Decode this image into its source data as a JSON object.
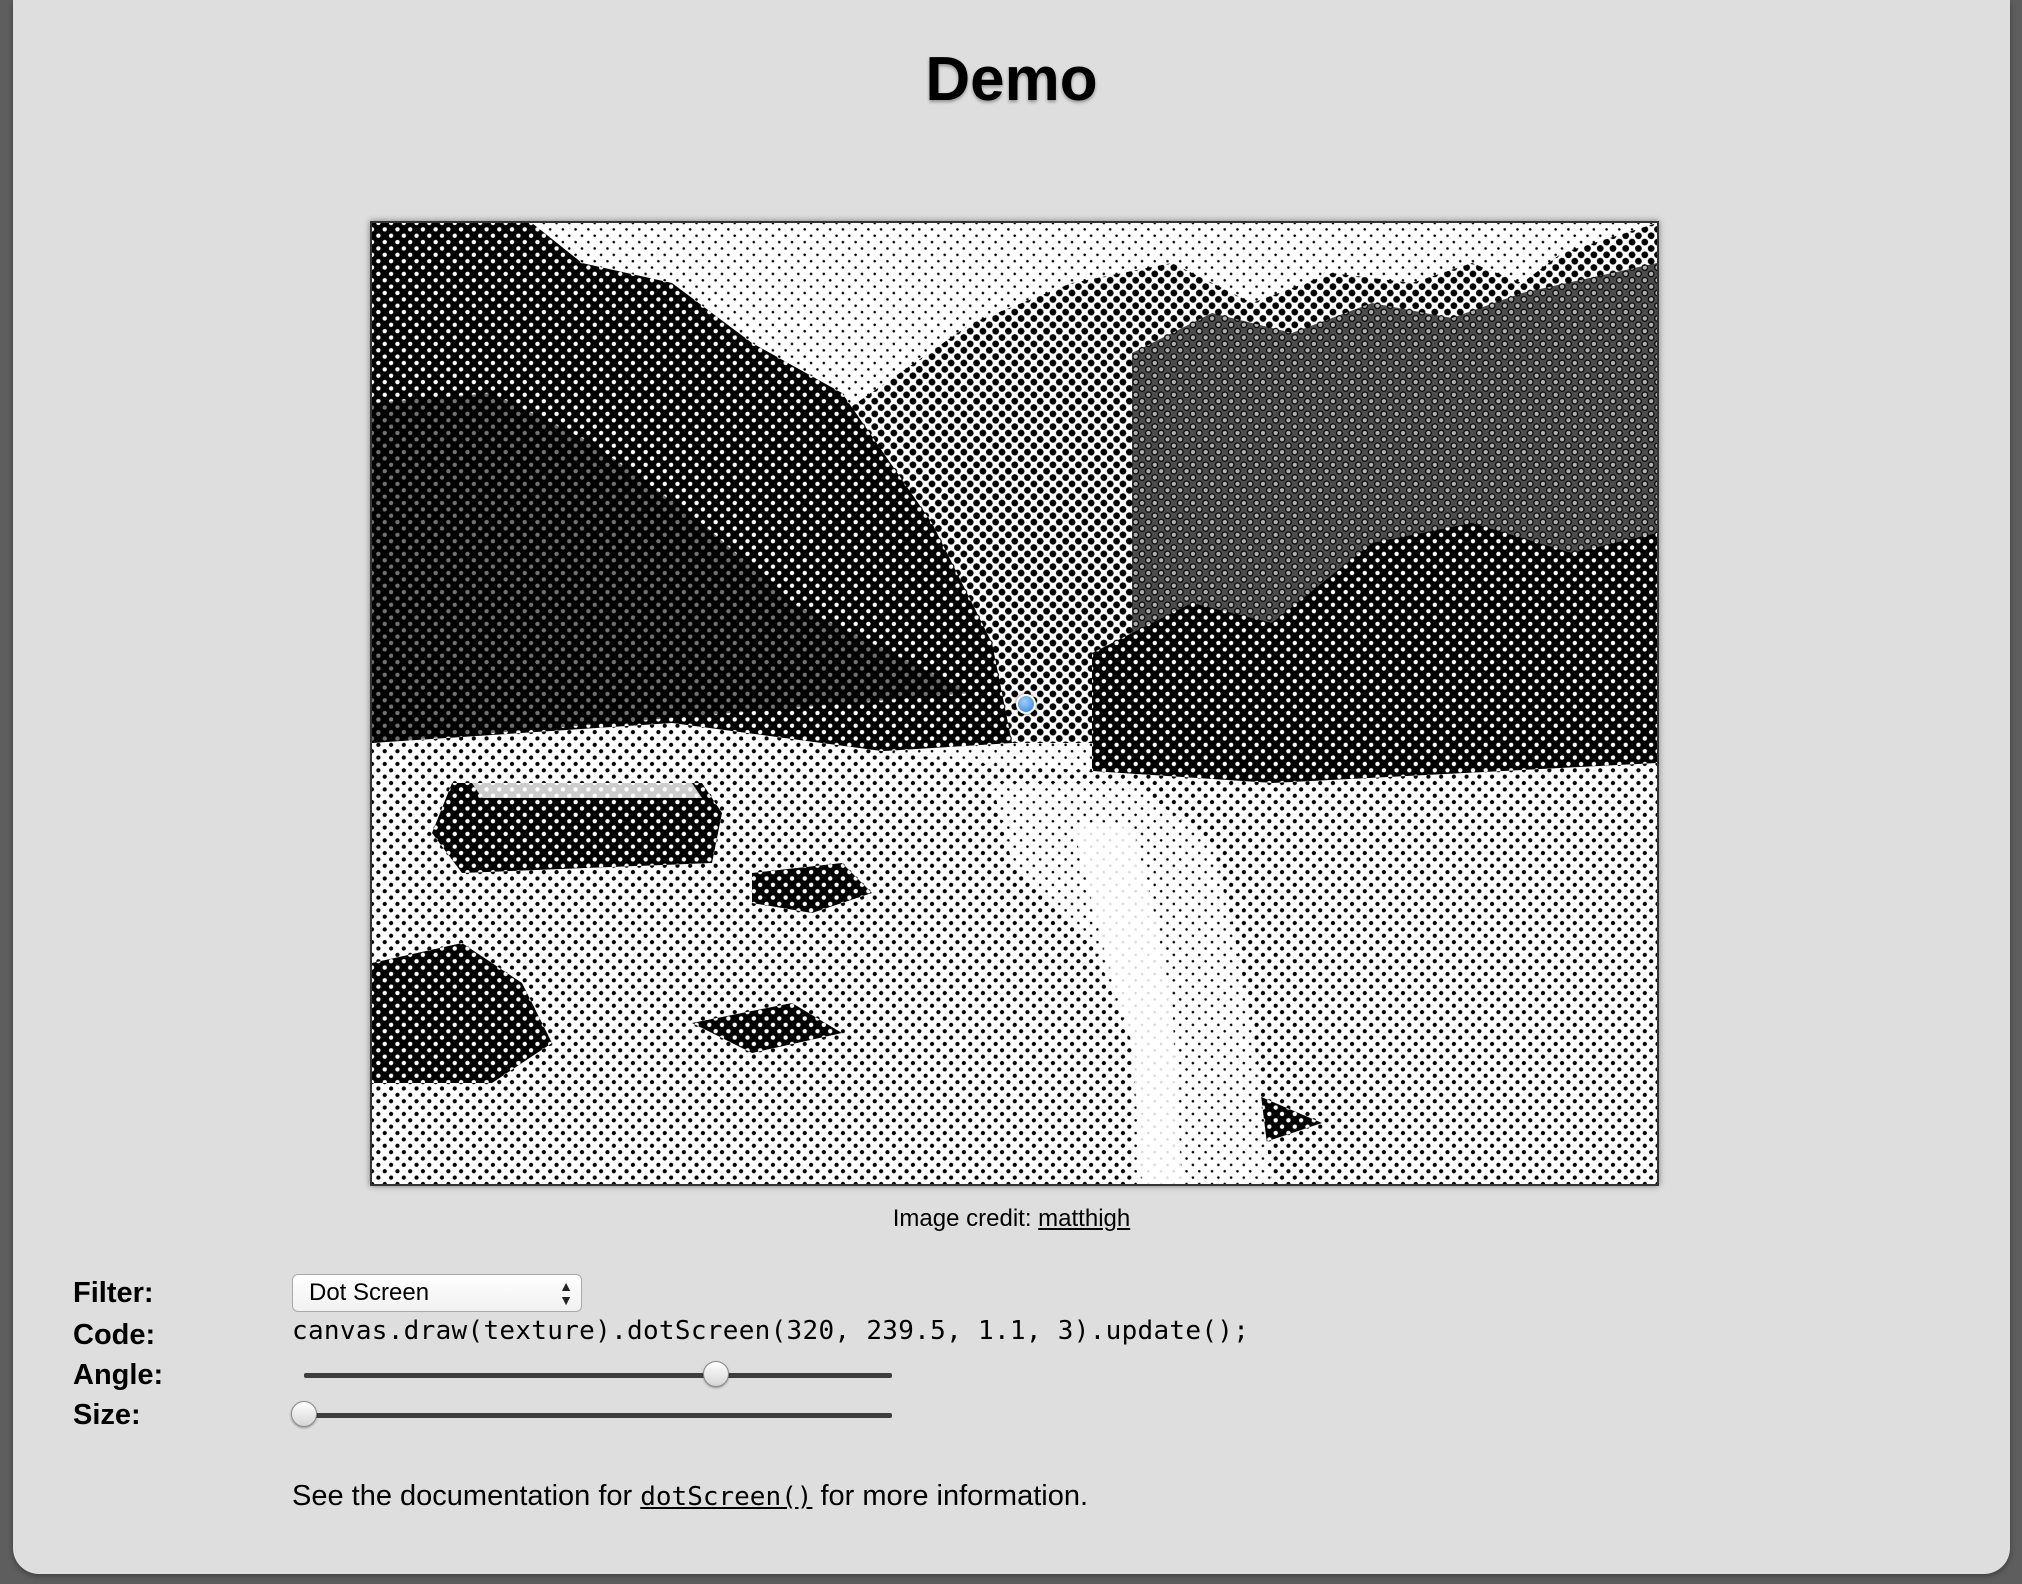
{
  "page": {
    "title": "Demo"
  },
  "image": {
    "credit_prefix": "Image credit: ",
    "credit_link": "matthigh"
  },
  "controls": {
    "filter_label": "Filter:",
    "filter_selected": "Dot Screen",
    "code_label": "Code:",
    "code_value": "canvas.draw(texture).dotScreen(320, 239.5, 1.1, 3).update();",
    "angle_label": "Angle:",
    "angle_value_fraction": 0.7,
    "size_label": "Size:",
    "size_value_fraction": 0.0
  },
  "docs": {
    "prefix": "See the documentation for ",
    "link": "dotScreen()",
    "suffix": " for more information."
  },
  "icons": {
    "select_arrows": "up-down-chevron-icon",
    "cursor": "blue-center-dot-icon"
  }
}
